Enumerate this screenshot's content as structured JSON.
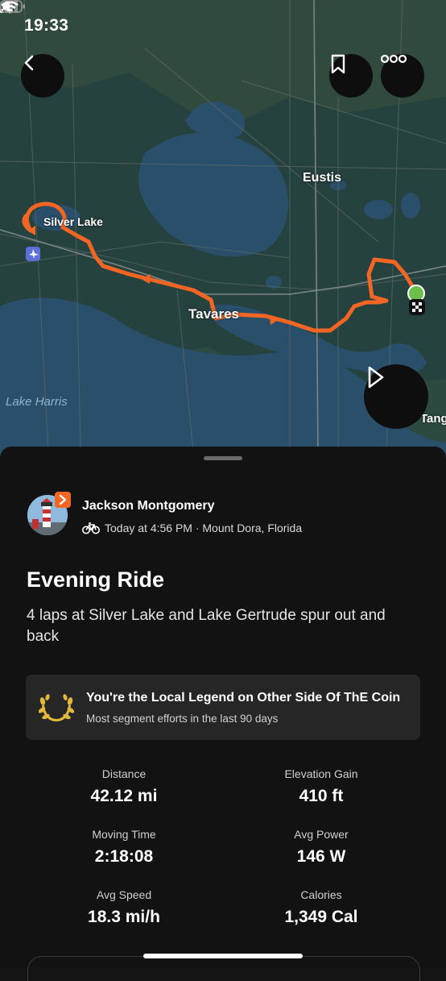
{
  "status_bar": {
    "time": "19:33"
  },
  "map": {
    "labels": {
      "eustis": "Eustis",
      "silver_lake": "Silver Lake",
      "tavares": "Tavares",
      "lake_harris": "Lake Harris",
      "tang": "Tang"
    }
  },
  "activity": {
    "athlete_name": "Jackson Montgomery",
    "meta": "Today at 4:56 PM · Mount Dora, Florida",
    "sport_icon": "bike-icon",
    "title": "Evening Ride",
    "description": "4 laps at Silver Lake and Lake Gertrude spur out and back"
  },
  "legend_card": {
    "title": "You're the Local Legend on Other Side Of ThE Coin",
    "subtitle": "Most segment efforts in the last 90 days"
  },
  "stats": [
    {
      "label": "Distance",
      "value": "42.12 mi"
    },
    {
      "label": "Elevation Gain",
      "value": "410 ft"
    },
    {
      "label": "Moving Time",
      "value": "2:18:08"
    },
    {
      "label": "Avg Power",
      "value": "146 W"
    },
    {
      "label": "Avg Speed",
      "value": "18.3 mi/h"
    },
    {
      "label": "Calories",
      "value": "1,349 Cal"
    }
  ],
  "colors": {
    "route": "#f26522",
    "start": "#6cc04a",
    "sheet": "#121212",
    "card": "#262626",
    "laurel": "#e2b93b"
  }
}
